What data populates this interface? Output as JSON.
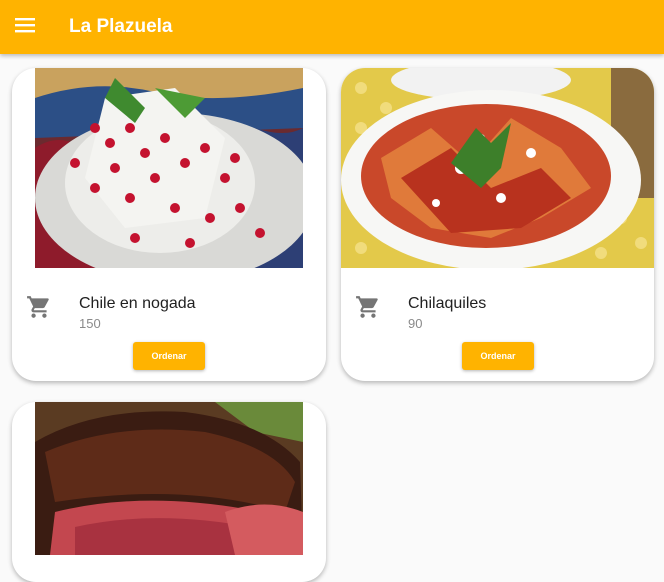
{
  "appbar": {
    "title": "La Plazuela",
    "menu_icon": "menu-icon",
    "color": "#ffb300"
  },
  "dishes": [
    {
      "name": "Chile en nogada",
      "price": "150",
      "button_label": "Ordenar",
      "icon": "cart-icon"
    },
    {
      "name": "Chilaquiles",
      "price": "90",
      "button_label": "Ordenar",
      "icon": "cart-icon"
    },
    {
      "name": "",
      "price": "",
      "button_label": "",
      "icon": ""
    }
  ]
}
